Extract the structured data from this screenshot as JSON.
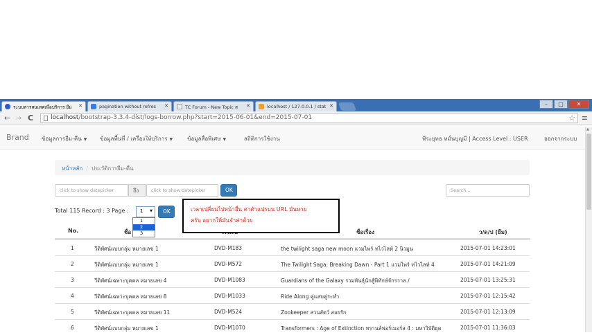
{
  "browser": {
    "tabs": [
      {
        "label": "ระบบสารสนเทศเพื่อบริการ ยืม",
        "color": "#2a5bd7"
      },
      {
        "label": "pagination without refres",
        "color": "#3b7ddd"
      },
      {
        "label": "TC Forum - New Topic ส",
        "color": "#eeeeee"
      },
      {
        "label": "localhost / 127.0.0.1 / stat",
        "color": "#f0a030"
      }
    ],
    "url_host": "localhost",
    "url_path": "/bootstrap-3.3.4-dist/logs-borrow.php?start=2015-06-01&end=2015-07-01"
  },
  "navbar": {
    "brand": "Brand",
    "items": [
      "ข้อมูลการยืม-คืน",
      "ข้อมูลพื้นที่ / เครื่องให้บริการ",
      "ข้อมูลสื่อพิเศษ"
    ],
    "stats": "สถิติการใช้งาน",
    "user": "พีระยุทธ หมั่นบุญมี | Access Level : USER",
    "logout": "ออกจากระบบ"
  },
  "breadcrumb": {
    "home": "หน้าหลัก",
    "current": "ประวัติการยืม-คืน"
  },
  "filters": {
    "start_placeholder": "click to show datepicker",
    "to_label": "ถึง",
    "end_placeholder": "click to show datepicker",
    "ok_label": "OK",
    "search_placeholder": "Search..."
  },
  "paging": {
    "summary": "Total 115 Record : 3 Page :",
    "selected": "1",
    "options": [
      "1",
      "2",
      "3"
    ],
    "highlighted": "2",
    "ok_label": "OK"
  },
  "note": {
    "line1": "เวลาเปลี่ยนไปหน้าอื่น  ค่าตัวแปรบน   URL มันหาย",
    "line2": "ครับ  อยากให้มันจำค่าด้วย"
  },
  "table": {
    "headers": [
      "No.",
      "ชื่อ",
      "รหัสสื่อ",
      "ชื่อเรื่อง",
      "ว/ด/ป (ยืม)"
    ],
    "rows": [
      [
        "1",
        "วีดิทัศน์แบบกลุ่ม หมายเลข 1",
        "DVD-M183",
        "the twilight saga new moon แวมไพร์ ทไวไลท์ 2 นิวมูน",
        "2015-07-01 14:23:01"
      ],
      [
        "2",
        "วีดิทัศน์แบบกลุ่ม หมายเลข 1",
        "DVD-M572",
        "The Twilight Saga: Breaking Dawn - Part 1 แวมไพร์ ทไวไลท์ 4",
        "2015-07-01 14:21:09"
      ],
      [
        "3",
        "วีดิทัศน์เฉพาะบุคคล หมายเลข 4",
        "DVD-M1083",
        "Guardians of the Galaxy รวมพันธุ์นักสู้พิทักษ์จักรวาล /",
        "2015-07-01 13:25:31"
      ],
      [
        "4",
        "วีดิทัศน์เฉพาะบุคคล หมายเลข 8",
        "DVD-M1033",
        "Ride Along คู่แสบคู่ระห่ำ",
        "2015-07-01 12:15:42"
      ],
      [
        "5",
        "วีดิทัศน์เฉพาะบุคคล หมายเลข 11",
        "DVD-M524",
        "Zookeeper สวนสัตว์ สอยรัก",
        "2015-07-01 12:13:09"
      ],
      [
        "6",
        "วีดิทัศน์แบบกลุ่ม หมายเลข 1",
        "DVD-M1070",
        "Transformers : Age of Extinction ทรานส์ฟอร์เมอร์ส 4 : มหาวิบัติยุค",
        "2015-07-01 11:36:03"
      ]
    ]
  }
}
